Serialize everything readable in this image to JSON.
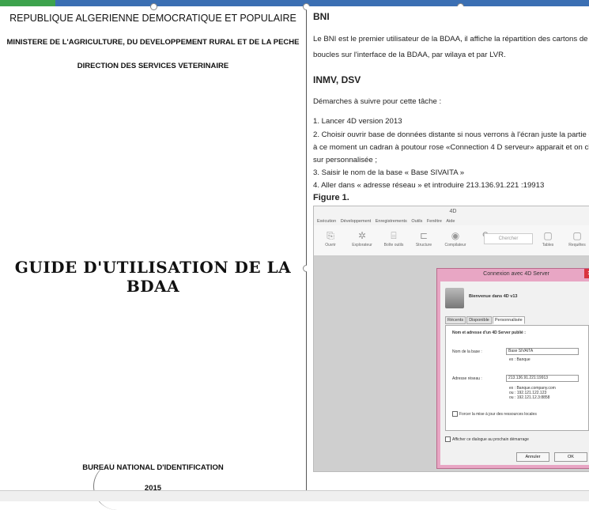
{
  "left_page": {
    "republic": "REPUBLIQUE ALGERIENNE DEMOCRATIQUE ET POPULAIRE",
    "ministry": "MINISTERE DE L'AGRICULTURE, DU DEVELOPPEMENT RURAL ET DE LA PECHE",
    "direction": "DIRECTION DES SERVICES VETERINAIRE",
    "title": "GUIDE D'UTILISATION DE LA BDAA",
    "bureau": "BUREAU NATIONAL D'IDENTIFICATION",
    "year": "2015"
  },
  "right_page": {
    "heading_bni": "BNI",
    "bni_line1": "Le BNI est le premier utilisateur de la BDAA, il  affiche la répartition des cartons de",
    "bni_line2": "boucles sur l'interface de la BDAA,  par wilaya et par LVR.",
    "heading_inmv": "INMV, DSV",
    "steps_intro": "Démarches à suivre pour cette tâche :",
    "step1": "1. Lancer 4D version 2013",
    "step2_line1": "2. Choisir ouvrir base de données distante si nous verrons à l'écran juste la partie g",
    "step2_line2": "à ce moment un cadran à poutour rose «Connection 4 D serveur» apparait et on cl",
    "step2_line3": "sur personnalisée ;",
    "step3": "3. Saisir le nom de la base « Base SIVAITA »",
    "step4": "4. Aller dans « adresse réseau » et introduire 213.136.91.221 :19913",
    "figure_caption": "Figure 1."
  },
  "screenshot": {
    "window_title": "4D",
    "menu": [
      "Exécution",
      "Développement",
      "Enregistrements",
      "Outils",
      "Fenêtre",
      "Aide"
    ],
    "tools": [
      "Ouvrir",
      "Explorateur",
      "Boîte outils",
      "Structure",
      "Compilateur",
      "Chercher",
      "Tables",
      "Requêtes"
    ],
    "dialog_title": "Connexion avec 4D Server",
    "welcome": "Bienvenue dans 4D v13",
    "tabs": [
      "Récents",
      "Disponible",
      "Personnalisée"
    ],
    "panel_title": "Nom et adresse d'un 4D Server publié :",
    "db_label": "Nom de la base :",
    "db_value": "Base SIVAITA",
    "db_example": "ex : Banque",
    "addr_label": "Adresse réseau :",
    "addr_value": "213.136.91.221:19913",
    "addr_example1": "ex : Banque.company.com",
    "addr_example2": "ou : 192.121.122.123",
    "addr_example3": "ou : 192.121.12.3:8858",
    "force_update": "Forcer la mise à jour des ressources locales",
    "show_next": "Afficher ce dialogue au prochain démarrage",
    "cancel": "Annuler",
    "ok": "OK"
  }
}
